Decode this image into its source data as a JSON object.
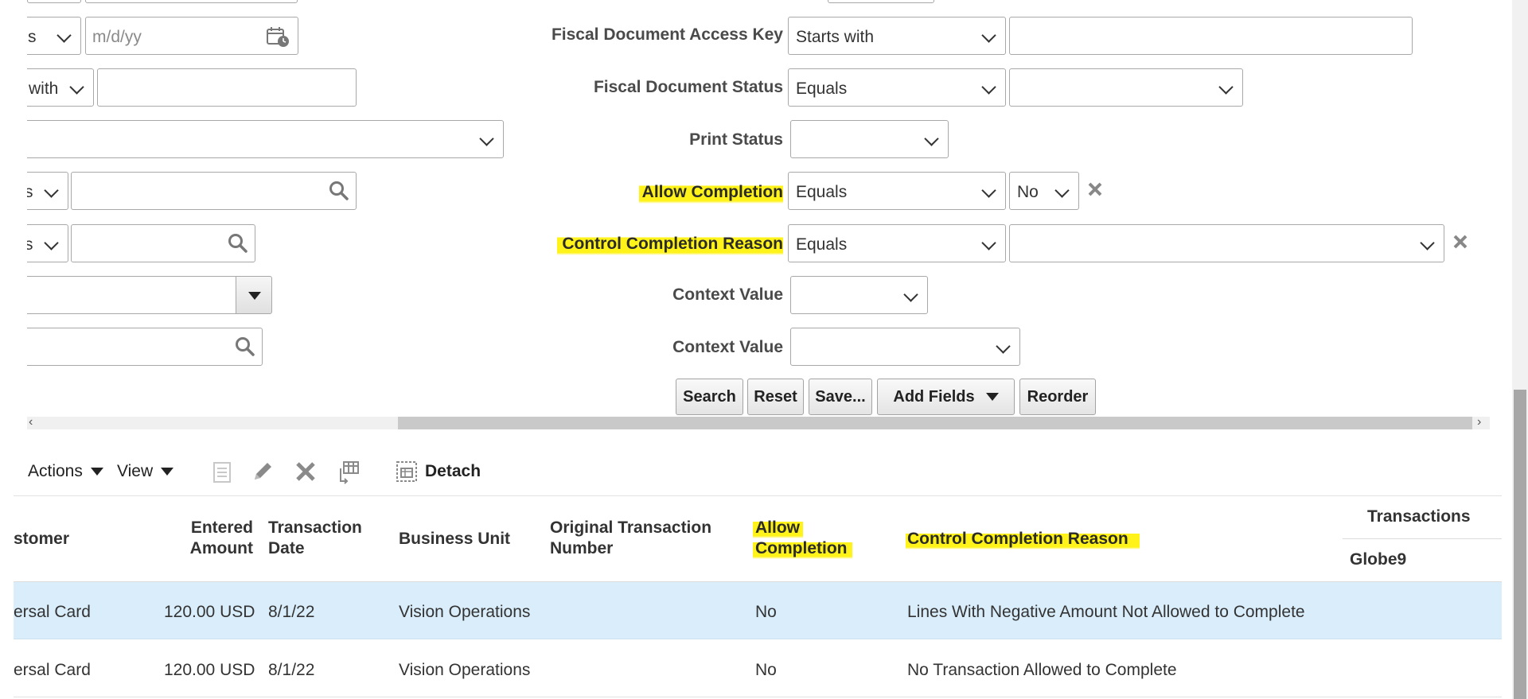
{
  "filters": {
    "left": {
      "op_row1": "s",
      "date_placeholder": "m/d/yy",
      "op_row2": "with",
      "op_row4": "s",
      "op_row5": "s"
    },
    "right": [
      {
        "label": "Fiscal Document Access Key",
        "operator": "Starts with",
        "value": ""
      },
      {
        "label": "Fiscal Document Status",
        "operator": "Equals",
        "value": ""
      },
      {
        "label": "Print Status",
        "operator": "",
        "value": ""
      },
      {
        "label": "Allow Completion",
        "operator": "Equals",
        "value": "No"
      },
      {
        "label": "Control Completion Reason",
        "operator": "Equals",
        "value": ""
      },
      {
        "label": "Context Value",
        "operator": "",
        "value": ""
      },
      {
        "label": "Context Value",
        "operator": "",
        "value": ""
      }
    ],
    "buttons": {
      "search": "Search",
      "reset": "Reset",
      "save": "Save...",
      "add_fields": "Add Fields",
      "reorder": "Reorder"
    }
  },
  "toolbar": {
    "actions": "Actions",
    "view": "View",
    "detach": "Detach"
  },
  "table": {
    "headers": {
      "customer": "stomer",
      "entered_amount_1": "Entered",
      "entered_amount_2": "Amount",
      "transaction_date_1": "Transaction",
      "transaction_date_2": "Date",
      "business_unit": "Business Unit",
      "original_txn_1": "Original Transaction",
      "original_txn_2": "Number",
      "allow_completion_1": "Allow",
      "allow_completion_2": "Completion",
      "control_reason": "Control Completion Reason",
      "transactions_group": "Transactions",
      "globe9": "Globe9"
    },
    "rows": [
      {
        "customer": "ersal Card",
        "amount": "120.00 USD",
        "date": "8/1/22",
        "business_unit": "Vision Operations",
        "original_number": "",
        "allow_completion": "No",
        "reason": "Lines With Negative Amount Not Allowed to Complete",
        "selected": true
      },
      {
        "customer": "ersal Card",
        "amount": "120.00 USD",
        "date": "8/1/22",
        "business_unit": "Vision Operations",
        "original_number": "",
        "allow_completion": "No",
        "reason": "No Transaction Allowed to Complete",
        "selected": false
      }
    ]
  },
  "colors": {
    "highlight": "#fff31a",
    "selected_row": "#d9edfb",
    "border": "#a8a8a8"
  }
}
